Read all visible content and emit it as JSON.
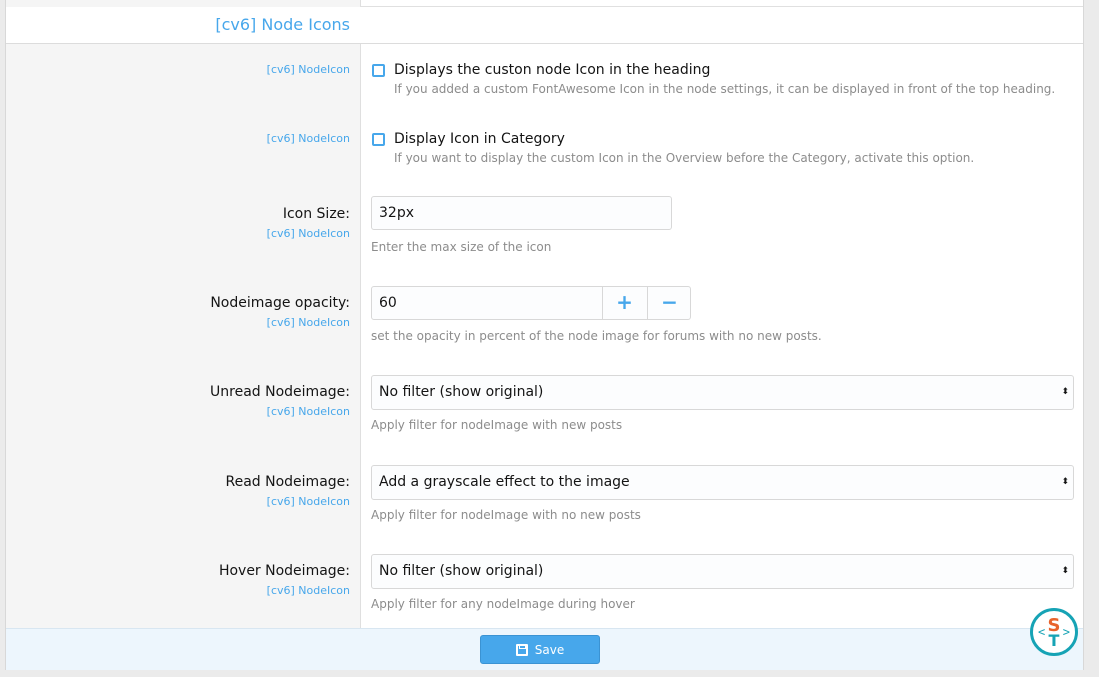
{
  "section": {
    "title": "[cv6] Node Icons"
  },
  "options": [
    {
      "addon": "[cv6] NodeIcon",
      "checkbox_label": "Displays the custon node Icon in the heading",
      "description": "If you added a custom FontAwesome Icon in the node settings, it can be displayed in front of the top heading.",
      "checked": false
    },
    {
      "addon": "[cv6] NodeIcon",
      "checkbox_label": "Display Icon in Category",
      "description": "If you want to display the custom Icon in the Overview before the Category, activate this option.",
      "checked": false
    },
    {
      "label": "Icon Size:",
      "addon": "[cv6] NodeIcon",
      "value": "32px",
      "description": "Enter the max size of the icon"
    },
    {
      "label": "Nodeimage opacity:",
      "addon": "[cv6] NodeIcon",
      "value": "60",
      "plus": "+",
      "minus": "−",
      "description": "set the opacity in percent of the node image for forums with no new posts."
    },
    {
      "label": "Unread Nodeimage:",
      "addon": "[cv6] NodeIcon",
      "value": "No filter (show original)",
      "description": "Apply filter for nodeImage with new posts"
    },
    {
      "label": "Read Nodeimage:",
      "addon": "[cv6] NodeIcon",
      "value": "Add a grayscale effect to the image",
      "description": "Apply filter for nodeImage with no new posts"
    },
    {
      "label": "Hover Nodeimage:",
      "addon": "[cv6] NodeIcon",
      "value": "No filter (show original)",
      "description": "Apply filter for any nodeImage during hover"
    }
  ],
  "footer": {
    "save_label": "Save"
  },
  "colors": {
    "accent": "#47a7eb",
    "muted": "#8c8c8c",
    "left_bg": "#f5f5f5",
    "footer_bg": "#edf6fd"
  },
  "icons": [
    "save-icon",
    "select-arrow-icon",
    "site-logo"
  ]
}
